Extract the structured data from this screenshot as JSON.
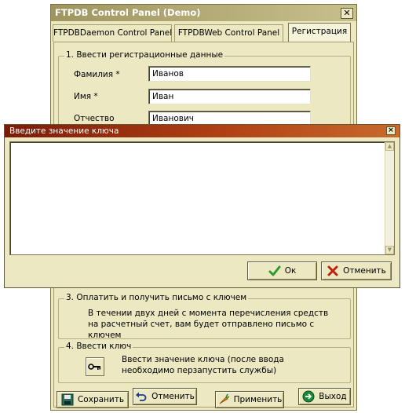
{
  "window": {
    "title": "FTPDB Control Panel (Demo)",
    "close_glyph": "✕"
  },
  "tabs": [
    {
      "label": "FTPDBDaemon Control Panel",
      "active": false
    },
    {
      "label": "FTPDBWeb Control Panel",
      "active": false
    },
    {
      "label": "Регистрация",
      "active": true
    }
  ],
  "registration": {
    "legend": "1. Ввести регистрационные данные",
    "fields": [
      {
        "label": "Фамилия *",
        "value": "Иванов"
      },
      {
        "label": "Имя *",
        "value": "Иван"
      },
      {
        "label": "Отчество",
        "value": "Иванович"
      }
    ]
  },
  "pay": {
    "legend": "3. Оплатить и получить письмо с ключем",
    "text": "В течении двух дней с момента перечисления средств на расчетный счет, вам будет отправлено письмо с ключем"
  },
  "enter_key": {
    "legend": "4. Ввести ключ",
    "text": "Ввести значение ключа (после ввода необходимо перзапустить службы)",
    "icon": "key-icon"
  },
  "bottom_buttons": {
    "save": "Сохранить",
    "cancel": "Отменить",
    "apply": "Применить",
    "exit": "Выход"
  },
  "dialog": {
    "title": "Введите значение ключа",
    "close_glyph": "×",
    "value": "",
    "ok_label": "Ок",
    "cancel_label": "Отменить"
  },
  "colors": {
    "window_bg": "#ece8c2",
    "dialog_title_bg": "#b04014",
    "ok_check": "#2e9a2e",
    "cancel_x": "#c02010"
  }
}
